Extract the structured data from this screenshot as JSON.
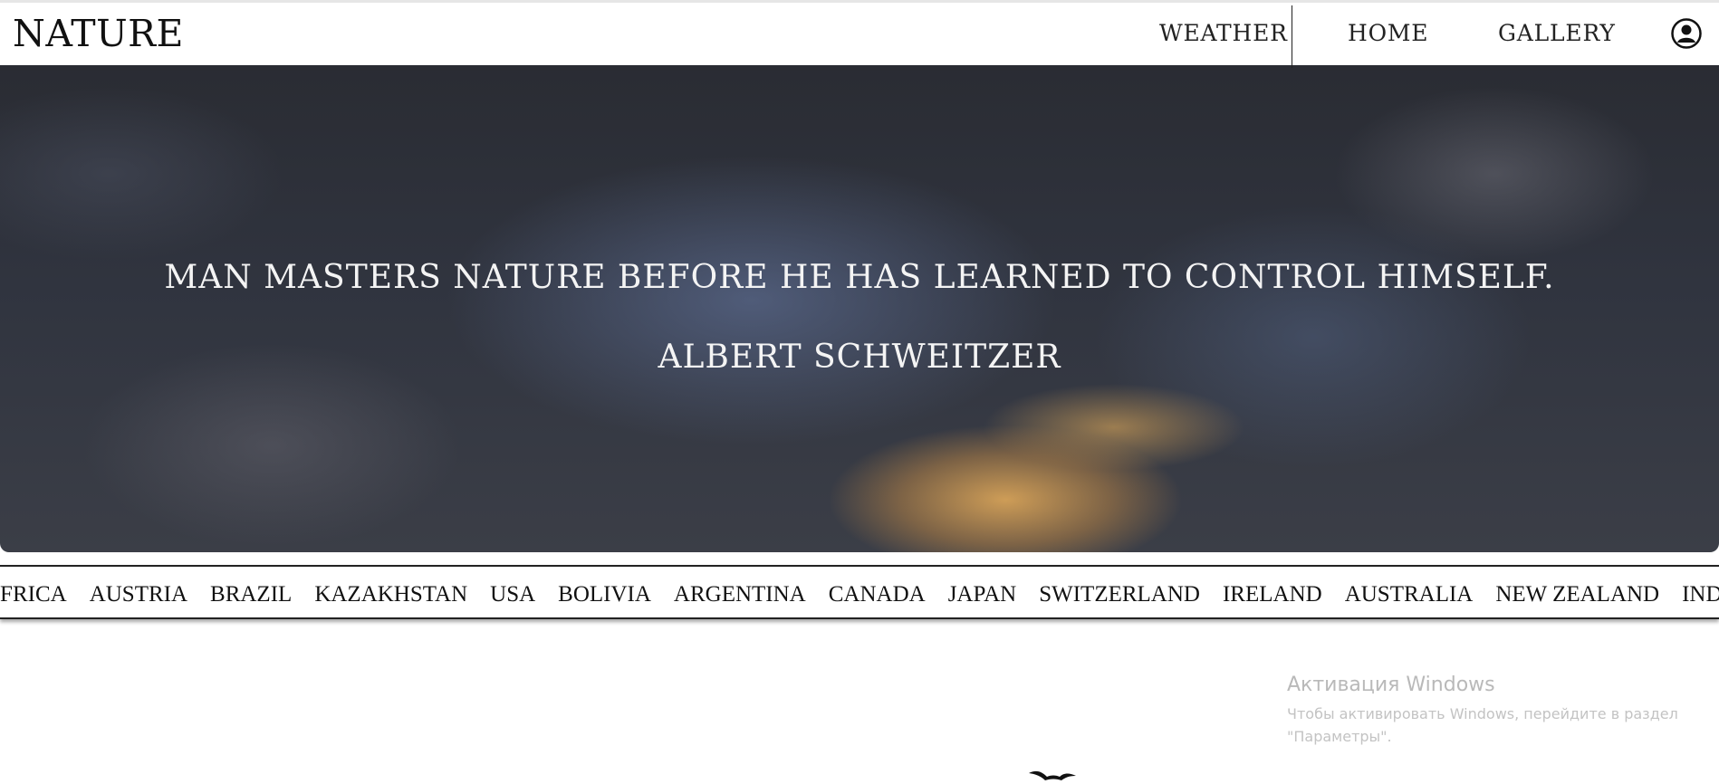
{
  "header": {
    "logo": "NATURE",
    "nav": {
      "weather": "WEATHER",
      "home": "HOME",
      "gallery": "GALLERY"
    },
    "user_icon": "user-circle-icon"
  },
  "hero": {
    "quote": "MAN MASTERS NATURE BEFORE HE HAS LEARNED TO CONTROL HIMSELF.",
    "author": "ALBERT SCHWEITZER"
  },
  "countries": [
    "AFRICA",
    "AUSTRIA",
    "BRAZIL",
    "KAZAKHSTAN",
    "USA",
    "BOLIVIA",
    "ARGENTINA",
    "CANADA",
    "JAPAN",
    "SWITZERLAND",
    "IRELAND",
    "AUSTRALIA",
    "NEW ZEALAND",
    "INDIA"
  ],
  "watermark": {
    "title": "Активация Windows",
    "line1": "Чтобы активировать Windows, перейдите в раздел",
    "line2": "\"Параметры\"."
  },
  "icons": {
    "bird": "bird-icon"
  }
}
